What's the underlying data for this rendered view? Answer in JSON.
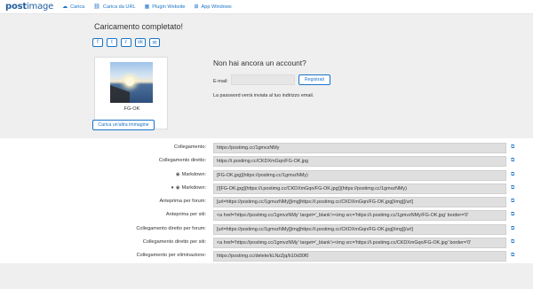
{
  "brand": {
    "logo_post": "post",
    "logo_image": "image"
  },
  "nav": [
    {
      "label": "Carica",
      "icon": "upload-cloud-icon"
    },
    {
      "label": "Carica da URL",
      "icon": "link-icon"
    },
    {
      "label": "Plugin Website",
      "icon": "puzzle-icon"
    },
    {
      "label": "App Windows",
      "icon": "windows-icon"
    }
  ],
  "upload": {
    "title": "Caricamento completato!",
    "thumbnail_label": "FG-OK",
    "upload_more_label": "Carica un'altra immagine",
    "share": [
      "f",
      "t",
      "r",
      "vk",
      "✉"
    ]
  },
  "account": {
    "title": "Non hai ancora un account?",
    "email_label": "E-mail:",
    "email_value": "",
    "register_label": "Registrati",
    "note": "La password verrà inviata al tuo indirizzo email."
  },
  "links": [
    {
      "label": "Collegamento:",
      "value": "https://postimg.cc/1gmvzNMy",
      "icon": ""
    },
    {
      "label": "Collegamento diretto:",
      "value": "https://i.postimg.cc/CKDXmGqn/FG-OK.jpg",
      "icon": ""
    },
    {
      "label": "Markdown:",
      "value": "[FG-OK.jpg](https://postimg.cc/1gmvzNMy)",
      "icon": "reddit-icon"
    },
    {
      "label": "Markdown:",
      "value": "[![FG-OK.jpg](https://i.postimg.cc/CKDXmGqn/FG-OK.jpg)](https://postimg.cc/1gmvzNMy)",
      "icon": "github-icon"
    },
    {
      "label": "Anteprima per forum:",
      "value": "[url=https://postimg.cc/1gmvzNMy][img]https://i.postimg.cc/CKDXmGqn/FG-OK.jpg[/img][/url]",
      "icon": ""
    },
    {
      "label": "Anteprima per siti:",
      "value": "<a href='https://postimg.cc/1gmvzNMy' target='_blank'><img src='https://i.postimg.cc/1gmvzNMy/FG-OK.jpg' border='0'",
      "icon": ""
    },
    {
      "label": "Collegamento diretto per forum:",
      "value": "[url=https://postimg.cc/1gmvzNMy][img]https://i.postimg.cc/CKDXmGqn/FG-OK.jpg[/img][/url]",
      "icon": ""
    },
    {
      "label": "Collegamento diretto per siti:",
      "value": "<a href='https://postimg.cc/1gmvzNMy' target='_blank'><img src='https://i.postimg.cc/CKDXmGqn/FG-OK.jpg' border='0'",
      "icon": ""
    },
    {
      "label": "Collegamento per eliminazione:",
      "value": "https://postimg.cc/delete/kLNzZjq/b10d30f0",
      "icon": ""
    }
  ],
  "colors": {
    "accent": "#1a73c8",
    "brand": "#1f5f9f",
    "panel": "#efefef"
  }
}
